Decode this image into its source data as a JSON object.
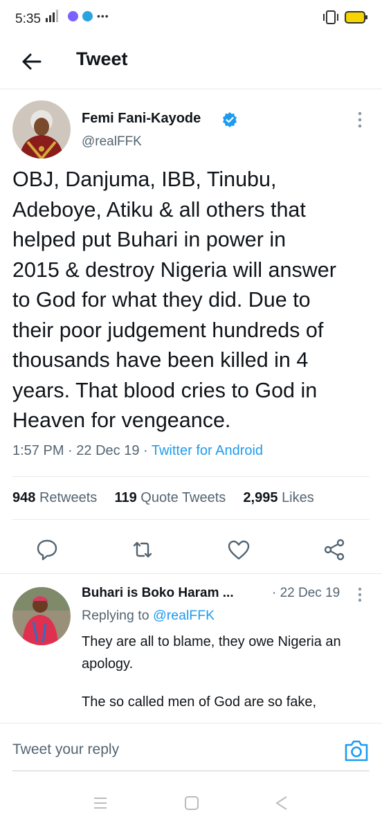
{
  "status_bar": {
    "time": "5:35"
  },
  "header": {
    "title": "Tweet"
  },
  "tweet": {
    "author_name": "Femi Fani-Kayode",
    "handle": "@realFFK",
    "text_lines": [
      "OBJ, Danjuma, IBB, Tinubu,",
      "Adeboye, Atiku & all others that",
      "helped put Buhari in power in",
      "2015 & destroy Nigeria will answer",
      "to God for what they did. Due to",
      "their poor judgement hundreds of",
      "thousands have been killed in 4",
      "years. That blood cries to God in",
      "Heaven for vengeance."
    ],
    "time": "1:57 PM",
    "date": "22 Dec 19",
    "source": "Twitter for Android",
    "retweets_count": "948",
    "retweets_label": "Retweets",
    "quotes_count": "119",
    "quotes_label": "Quote Tweets",
    "likes_count": "2,995",
    "likes_label": "Likes"
  },
  "reply": {
    "author_name": "Buhari is Boko Haram ...",
    "date": "22 Dec 19",
    "replying_prefix": "Replying to",
    "replying_handle": "@realFFK",
    "text": "They are all to blame, they owe Nigeria an apology.",
    "text2": "The so called men of God are so fake,"
  },
  "reply_bar": {
    "placeholder": "Tweet your reply"
  },
  "colors": {
    "accent": "#1d9bf0",
    "secondary_text": "#536471",
    "primary_text": "#0f1419"
  }
}
